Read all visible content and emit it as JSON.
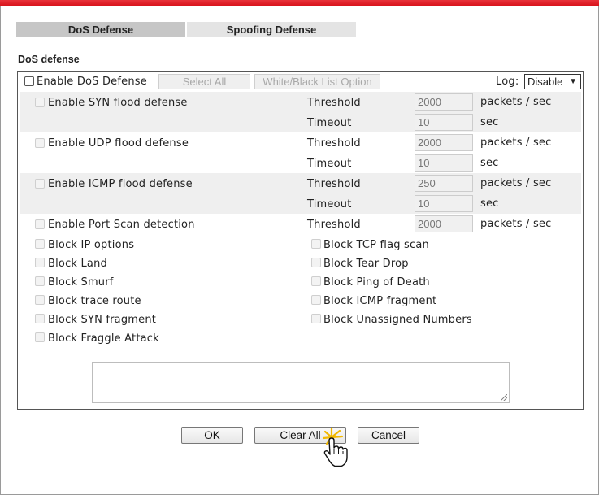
{
  "tabs": {
    "dos": "DoS Defense",
    "spoofing": "Spoofing Defense"
  },
  "section_title": "DoS defense",
  "header": {
    "enable_label": "Enable DoS Defense",
    "select_all": "Select All",
    "wb_list": "White/Black List Option",
    "log_label": "Log:",
    "log_value": "Disable"
  },
  "floods": {
    "syn": {
      "label": "Enable SYN flood defense",
      "threshold": "2000",
      "timeout": "10"
    },
    "udp": {
      "label": "Enable UDP flood defense",
      "threshold": "2000",
      "timeout": "10"
    },
    "icmp": {
      "label": "Enable ICMP flood defense",
      "threshold": "250",
      "timeout": "10"
    },
    "port": {
      "label": "Enable Port Scan detection",
      "threshold": "2000"
    }
  },
  "words": {
    "threshold": "Threshold",
    "timeout": "Timeout",
    "pps": "packets / sec",
    "sec": "sec"
  },
  "blocks_left": [
    "Block IP options",
    "Block Land",
    "Block Smurf",
    "Block trace route",
    "Block SYN fragment",
    "Block Fraggle Attack"
  ],
  "blocks_right": [
    "Block TCP flag scan",
    "Block Tear Drop",
    "Block Ping of Death",
    "Block ICMP fragment",
    "Block Unassigned Numbers"
  ],
  "buttons": {
    "ok": "OK",
    "clear_all": "Clear All",
    "cancel": "Cancel"
  }
}
